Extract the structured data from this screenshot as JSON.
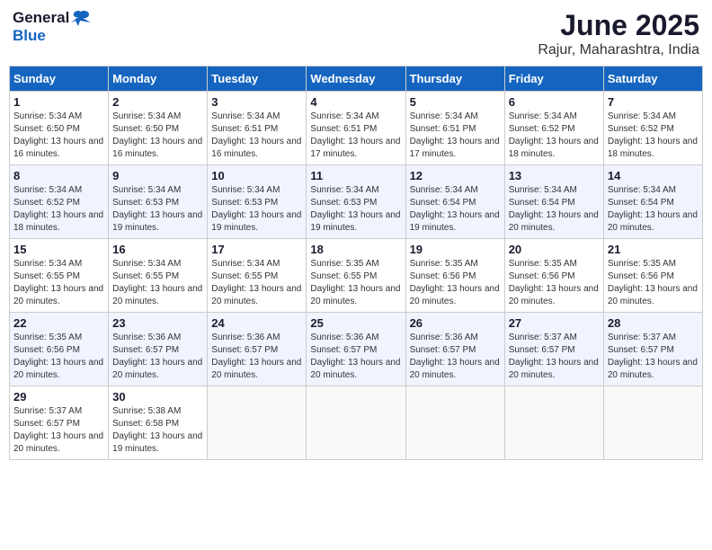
{
  "logo": {
    "general": "General",
    "blue": "Blue"
  },
  "title": {
    "month": "June 2025",
    "location": "Rajur, Maharashtra, India"
  },
  "headers": [
    "Sunday",
    "Monday",
    "Tuesday",
    "Wednesday",
    "Thursday",
    "Friday",
    "Saturday"
  ],
  "weeks": [
    [
      {
        "day": "1",
        "sunrise": "5:34 AM",
        "sunset": "6:50 PM",
        "daylight": "13 hours and 16 minutes."
      },
      {
        "day": "2",
        "sunrise": "5:34 AM",
        "sunset": "6:50 PM",
        "daylight": "13 hours and 16 minutes."
      },
      {
        "day": "3",
        "sunrise": "5:34 AM",
        "sunset": "6:51 PM",
        "daylight": "13 hours and 16 minutes."
      },
      {
        "day": "4",
        "sunrise": "5:34 AM",
        "sunset": "6:51 PM",
        "daylight": "13 hours and 17 minutes."
      },
      {
        "day": "5",
        "sunrise": "5:34 AM",
        "sunset": "6:51 PM",
        "daylight": "13 hours and 17 minutes."
      },
      {
        "day": "6",
        "sunrise": "5:34 AM",
        "sunset": "6:52 PM",
        "daylight": "13 hours and 18 minutes."
      },
      {
        "day": "7",
        "sunrise": "5:34 AM",
        "sunset": "6:52 PM",
        "daylight": "13 hours and 18 minutes."
      }
    ],
    [
      {
        "day": "8",
        "sunrise": "5:34 AM",
        "sunset": "6:52 PM",
        "daylight": "13 hours and 18 minutes."
      },
      {
        "day": "9",
        "sunrise": "5:34 AM",
        "sunset": "6:53 PM",
        "daylight": "13 hours and 19 minutes."
      },
      {
        "day": "10",
        "sunrise": "5:34 AM",
        "sunset": "6:53 PM",
        "daylight": "13 hours and 19 minutes."
      },
      {
        "day": "11",
        "sunrise": "5:34 AM",
        "sunset": "6:53 PM",
        "daylight": "13 hours and 19 minutes."
      },
      {
        "day": "12",
        "sunrise": "5:34 AM",
        "sunset": "6:54 PM",
        "daylight": "13 hours and 19 minutes."
      },
      {
        "day": "13",
        "sunrise": "5:34 AM",
        "sunset": "6:54 PM",
        "daylight": "13 hours and 20 minutes."
      },
      {
        "day": "14",
        "sunrise": "5:34 AM",
        "sunset": "6:54 PM",
        "daylight": "13 hours and 20 minutes."
      }
    ],
    [
      {
        "day": "15",
        "sunrise": "5:34 AM",
        "sunset": "6:55 PM",
        "daylight": "13 hours and 20 minutes."
      },
      {
        "day": "16",
        "sunrise": "5:34 AM",
        "sunset": "6:55 PM",
        "daylight": "13 hours and 20 minutes."
      },
      {
        "day": "17",
        "sunrise": "5:34 AM",
        "sunset": "6:55 PM",
        "daylight": "13 hours and 20 minutes."
      },
      {
        "day": "18",
        "sunrise": "5:35 AM",
        "sunset": "6:55 PM",
        "daylight": "13 hours and 20 minutes."
      },
      {
        "day": "19",
        "sunrise": "5:35 AM",
        "sunset": "6:56 PM",
        "daylight": "13 hours and 20 minutes."
      },
      {
        "day": "20",
        "sunrise": "5:35 AM",
        "sunset": "6:56 PM",
        "daylight": "13 hours and 20 minutes."
      },
      {
        "day": "21",
        "sunrise": "5:35 AM",
        "sunset": "6:56 PM",
        "daylight": "13 hours and 20 minutes."
      }
    ],
    [
      {
        "day": "22",
        "sunrise": "5:35 AM",
        "sunset": "6:56 PM",
        "daylight": "13 hours and 20 minutes."
      },
      {
        "day": "23",
        "sunrise": "5:36 AM",
        "sunset": "6:57 PM",
        "daylight": "13 hours and 20 minutes."
      },
      {
        "day": "24",
        "sunrise": "5:36 AM",
        "sunset": "6:57 PM",
        "daylight": "13 hours and 20 minutes."
      },
      {
        "day": "25",
        "sunrise": "5:36 AM",
        "sunset": "6:57 PM",
        "daylight": "13 hours and 20 minutes."
      },
      {
        "day": "26",
        "sunrise": "5:36 AM",
        "sunset": "6:57 PM",
        "daylight": "13 hours and 20 minutes."
      },
      {
        "day": "27",
        "sunrise": "5:37 AM",
        "sunset": "6:57 PM",
        "daylight": "13 hours and 20 minutes."
      },
      {
        "day": "28",
        "sunrise": "5:37 AM",
        "sunset": "6:57 PM",
        "daylight": "13 hours and 20 minutes."
      }
    ],
    [
      {
        "day": "29",
        "sunrise": "5:37 AM",
        "sunset": "6:57 PM",
        "daylight": "13 hours and 20 minutes."
      },
      {
        "day": "30",
        "sunrise": "5:38 AM",
        "sunset": "6:58 PM",
        "daylight": "13 hours and 19 minutes."
      },
      null,
      null,
      null,
      null,
      null
    ]
  ],
  "labels": {
    "sunrise": "Sunrise:",
    "sunset": "Sunset:",
    "daylight": "Daylight:"
  }
}
